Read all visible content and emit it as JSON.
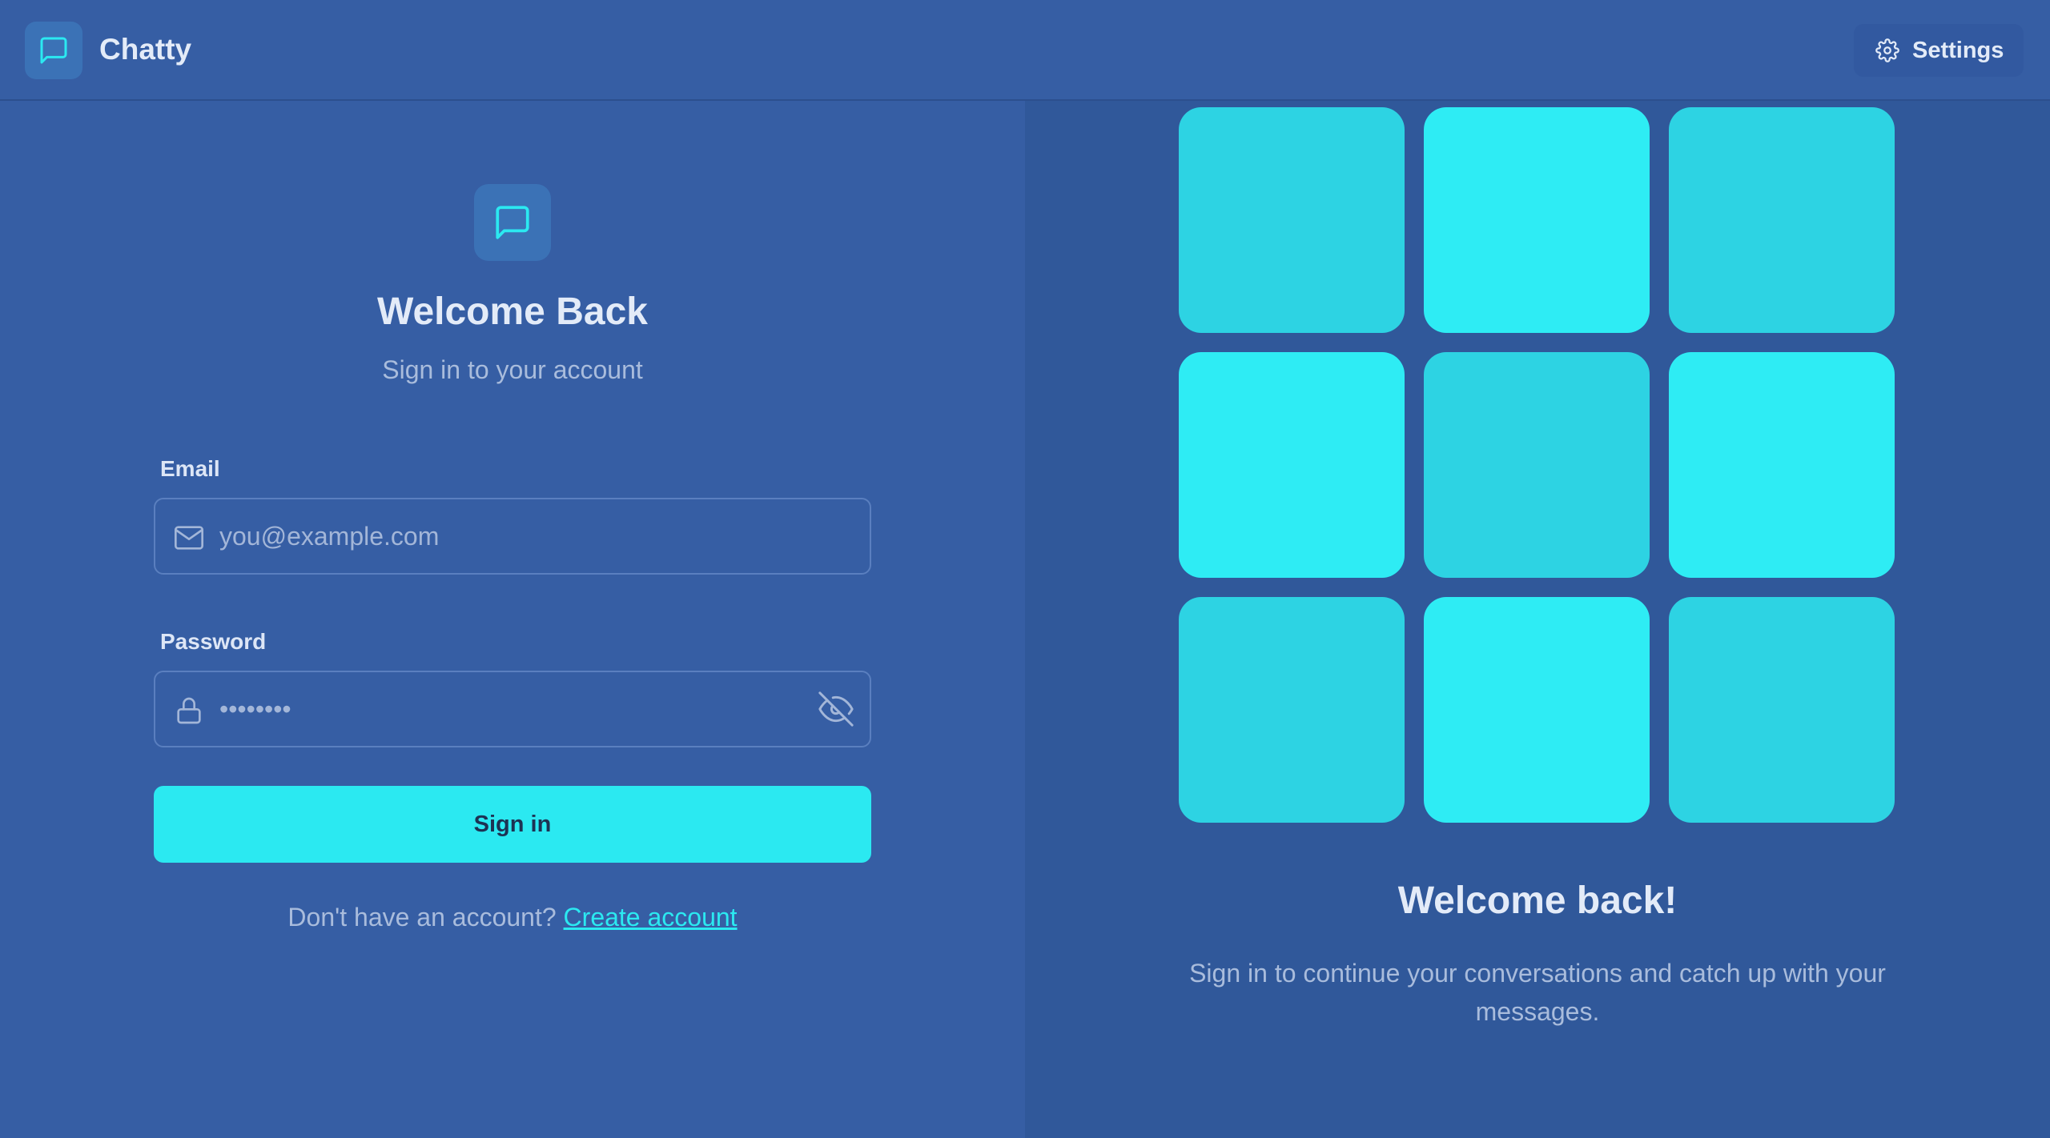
{
  "header": {
    "brand": "Chatty",
    "settings_label": "Settings"
  },
  "login": {
    "title": "Welcome Back",
    "subtitle": "Sign in to your account",
    "email_label": "Email",
    "email_placeholder": "you@example.com",
    "email_value": "",
    "password_label": "Password",
    "password_placeholder": "••••••••",
    "password_value": "",
    "submit_label": "Sign in",
    "signup_prompt": "Don't have an account?",
    "signup_link": "Create account"
  },
  "promo": {
    "title": "Welcome back!",
    "subtitle": "Sign in to continue your conversations and catch up with your messages.",
    "tiles": [
      "dim",
      "bright",
      "dim",
      "bright",
      "dim",
      "bright",
      "dim",
      "bright",
      "dim"
    ]
  },
  "colors": {
    "background": "#365ea4",
    "panel_right": "#30589a",
    "accent": "#2be9f1",
    "tile_dim": "#2dd3e3",
    "tile_bright": "#2eecf4",
    "text_primary": "#e3ebf8",
    "text_muted": "#a9bcdc"
  },
  "icons": {
    "logo": "message-square-icon",
    "settings": "gear-icon",
    "email": "mail-icon",
    "password": "lock-icon",
    "toggle_password": "eye-off-icon"
  }
}
